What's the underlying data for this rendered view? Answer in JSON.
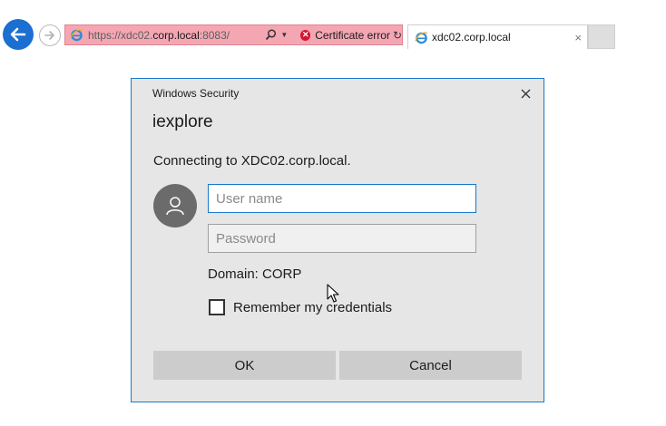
{
  "browser": {
    "address": {
      "scheme": "https://",
      "sub": "xdc02.",
      "host": "corp.local",
      "path": ":8083/",
      "cert_error": "Certificate error"
    },
    "tab": {
      "label": "xdc02.corp.local",
      "close": "×"
    },
    "colors": {
      "address_error_bg": "#f4a6b3",
      "back_button": "#1a6fd1"
    }
  },
  "dialog": {
    "title": "Windows Security",
    "app_name": "iexplore",
    "message": "Connecting to XDC02.corp.local.",
    "username_placeholder": "User name",
    "password_placeholder": "Password",
    "domain": "Domain: CORP",
    "remember_label": "Remember my credentials",
    "remember_checked": false,
    "ok_label": "OK",
    "cancel_label": "Cancel",
    "colors": {
      "accent": "#1979ca",
      "background": "#e6e6e6",
      "button": "#cccccc"
    }
  }
}
